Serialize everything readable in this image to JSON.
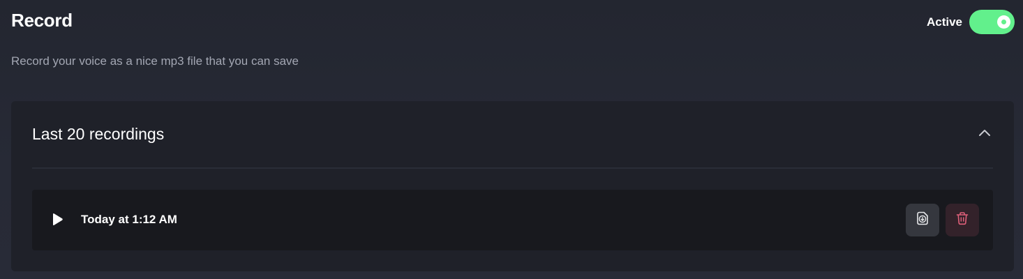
{
  "header": {
    "title": "Record",
    "subtitle": "Record your voice as a nice mp3 file that you can save",
    "status_label": "Active",
    "toggle_on": true
  },
  "recordings": {
    "section_title": "Last 20 recordings",
    "expanded": true,
    "items": [
      {
        "label": "Today at 1:12 AM",
        "play_icon": "play-icon",
        "download_icon": "download-file-icon",
        "delete_icon": "trash-icon"
      }
    ]
  },
  "colors": {
    "toggle_on": "#62f08c",
    "delete_accent": "#e0607a",
    "icon_light": "#e6e7ea"
  }
}
